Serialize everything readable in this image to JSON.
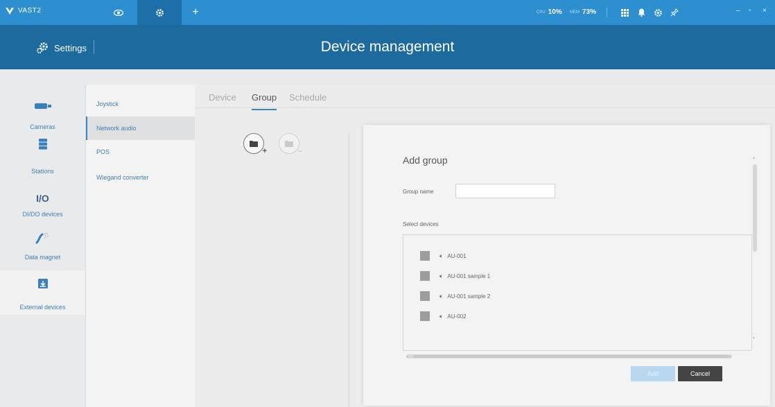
{
  "app": {
    "name": "VAST2"
  },
  "topbar": {
    "cpu_label": "CPU",
    "cpu_value": "10%",
    "mem_label": "MEM",
    "mem_value": "73%",
    "accent": "#2e8fd0",
    "icons": [
      "eye-icon",
      "gear-icon",
      "plus-icon",
      "grid-icon",
      "bell-icon",
      "gear-icon",
      "pin-icon"
    ],
    "add_label": "+",
    "window": {
      "minimize": "–",
      "maximize": "▫",
      "close": "×"
    }
  },
  "header": {
    "settings_label": "Settings",
    "title": "Device management",
    "color": "#1c6a9e"
  },
  "leftnav": {
    "items": [
      {
        "label": "Cameras",
        "icon": "camera-icon"
      },
      {
        "label": "Stations",
        "icon": "server-icon"
      },
      {
        "label": "DI/DO devices",
        "icon": "io-icon",
        "icon_text": "I/O"
      },
      {
        "label": "Data magnet",
        "icon": "magnet-icon"
      },
      {
        "label": "External devices",
        "icon": "external-device-icon",
        "active": true
      }
    ]
  },
  "submenu": {
    "items": [
      {
        "label": "Joystick"
      },
      {
        "label": "Network audio",
        "active": true
      },
      {
        "label": "POS"
      },
      {
        "label": "Wiegand converter"
      }
    ]
  },
  "tabs": [
    {
      "label": "Device"
    },
    {
      "label": "Group",
      "active": true
    },
    {
      "label": "Schedule"
    }
  ],
  "toolbar": {
    "add_group_icon": "folder-add-icon",
    "remove_group_icon": "folder-remove-icon",
    "add_mark": "+",
    "remove_mark": "–"
  },
  "dialog": {
    "title": "Add group",
    "group_name_label": "Group name",
    "group_name_value": "",
    "select_devices_label": "Select devices",
    "devices": [
      {
        "name": "AU-001"
      },
      {
        "name": "AU-001 sample 1"
      },
      {
        "name": "AU-001 sample 2"
      },
      {
        "name": "AU-002"
      }
    ],
    "add_label": "Add",
    "cancel_label": "Cancel"
  }
}
